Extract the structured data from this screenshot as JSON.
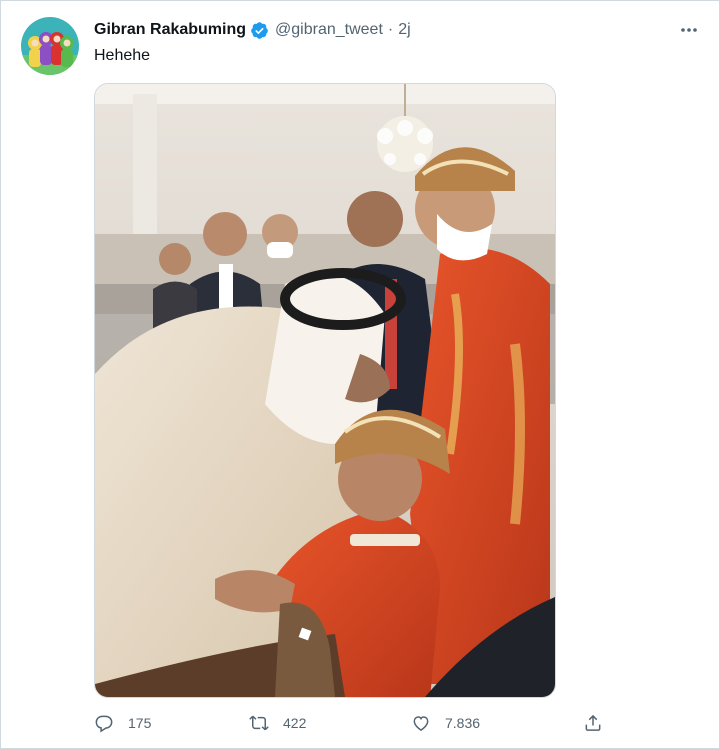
{
  "tweet": {
    "author_name": "Gibran Rakabuming",
    "handle": "@gibran_tweet",
    "separator": "·",
    "time": "2j",
    "text": "Hehehe",
    "verified": true
  },
  "actions": {
    "replies": "175",
    "retweets": "422",
    "likes": "7.836"
  },
  "icons": {
    "reply": "reply-icon",
    "retweet": "retweet-icon",
    "like": "like-icon",
    "share": "share-icon",
    "more": "more-icon",
    "verified": "verified-badge-icon"
  },
  "colors": {
    "name": "#0f1419",
    "secondary": "#536471",
    "verified": "#1d9bf0",
    "border": "#cfd9de"
  }
}
